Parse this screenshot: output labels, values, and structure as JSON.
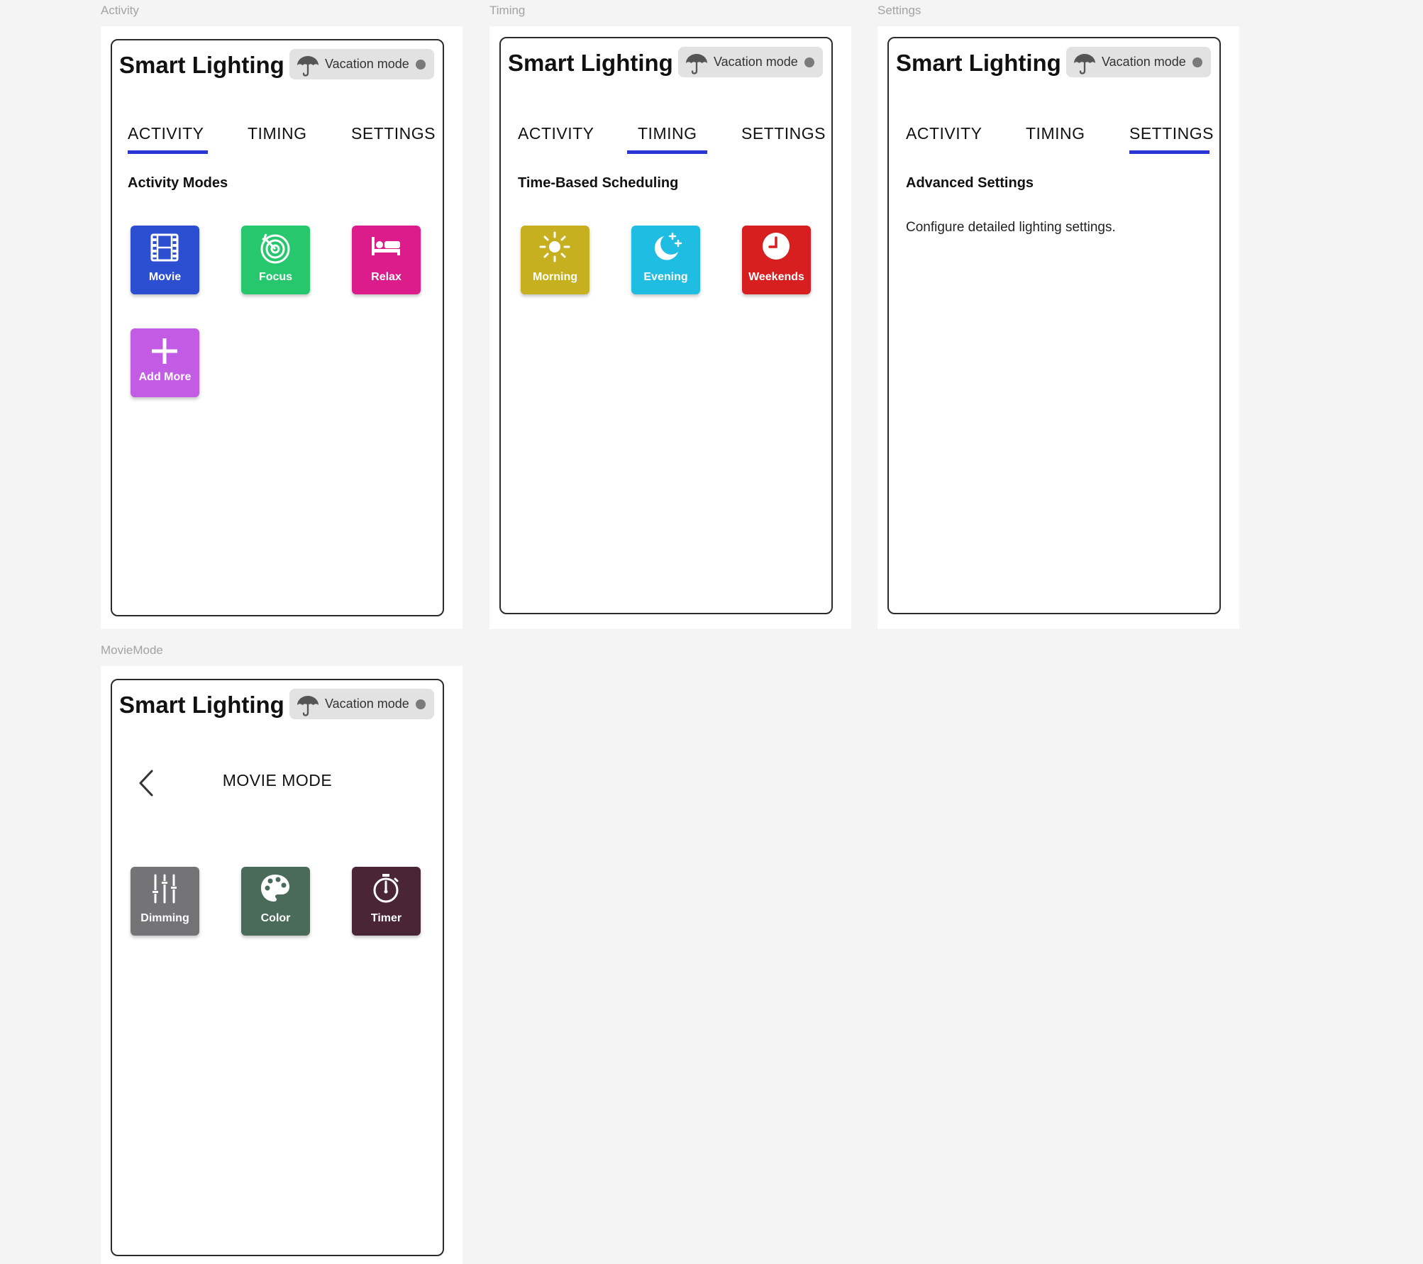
{
  "app": {
    "title": "Smart Lighting",
    "vacation_label": "Vacation mode"
  },
  "tabs": {
    "activity": "ACTIVITY",
    "timing": "TIMING",
    "settings": "SETTINGS"
  },
  "colors": {
    "accent_underline": "#2b36d6",
    "toggle_bg": "#e2e2e2",
    "toggle_dot": "#7a7a7a"
  },
  "frames": {
    "activity": {
      "label": "Activity",
      "section_title": "Activity Modes",
      "tiles": [
        {
          "label": "Movie",
          "icon": "film-icon",
          "color": "#2c4ed1"
        },
        {
          "label": "Focus",
          "icon": "target-icon",
          "color": "#27c76e"
        },
        {
          "label": "Relax",
          "icon": "bed-icon",
          "color": "#dd1c8b"
        },
        {
          "label": "Add More",
          "icon": "plus-icon",
          "color": "#c35ce4"
        }
      ]
    },
    "timing": {
      "label": "Timing",
      "section_title": "Time-Based Scheduling",
      "tiles": [
        {
          "label": "Morning",
          "icon": "sun-icon",
          "color": "#c6b020"
        },
        {
          "label": "Evening",
          "icon": "moon-stars-icon",
          "color": "#1fbde2"
        },
        {
          "label": "Weekends",
          "icon": "clock-icon",
          "color": "#d81f20"
        }
      ]
    },
    "settings": {
      "label": "Settings",
      "section_title": "Advanced Settings",
      "description": "Configure detailed lighting settings."
    },
    "moviemode": {
      "label": "MovieMode",
      "screen_title": "MOVIE MODE",
      "tiles": [
        {
          "label": "Dimming",
          "icon": "sliders-icon",
          "color": "#747477"
        },
        {
          "label": "Color",
          "icon": "palette-icon",
          "color": "#4a6b5a"
        },
        {
          "label": "Timer",
          "icon": "stopwatch-icon",
          "color": "#4a2535"
        }
      ]
    }
  }
}
